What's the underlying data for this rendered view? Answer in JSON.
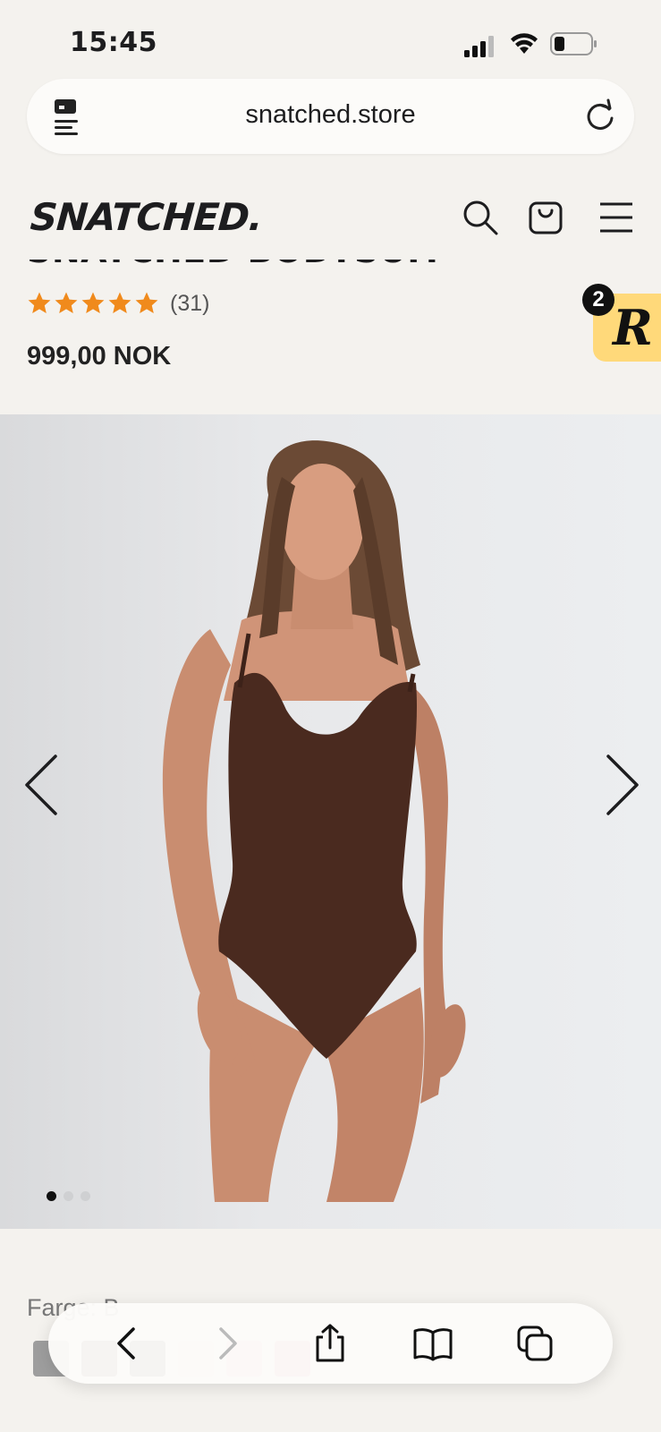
{
  "status_bar": {
    "time": "15:45",
    "icons": [
      "signal-icon",
      "wifi-icon",
      "battery-icon"
    ]
  },
  "browser": {
    "url": "snatched.store",
    "left_icon": "page-menu-icon",
    "right_icon": "reload-icon"
  },
  "site_header": {
    "logo": "SNATCHED.",
    "icons": [
      "search-icon",
      "cart-icon",
      "menu-icon"
    ]
  },
  "product": {
    "title_partial": "SNATCHED BODYSUIT",
    "rating_stars": 5,
    "review_count": "(31)",
    "price": "999,00 NOK"
  },
  "rewards_badge": {
    "letter": "R",
    "count": "2"
  },
  "gallery": {
    "image_alt": "model wearing brown bodysuit",
    "slides_total": 3,
    "active_slide": 1
  },
  "variant": {
    "color_label_partial": "Farge: B"
  },
  "toolbar": {
    "buttons": [
      "back-icon",
      "forward-icon",
      "share-icon",
      "bookmarks-icon",
      "tabs-icon"
    ]
  },
  "colors": {
    "background": "#f4f2ee",
    "star": "#f08a1c",
    "badge": "#ffd97a",
    "bodysuit": "#4a2a1f"
  }
}
